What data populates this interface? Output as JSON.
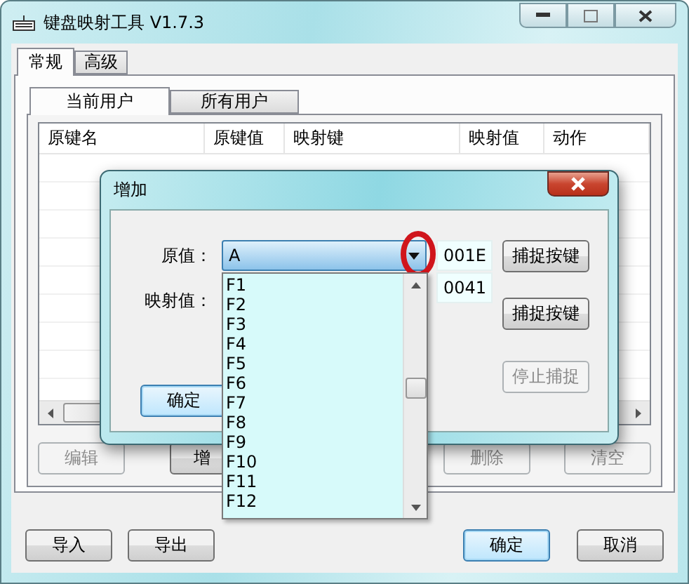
{
  "window": {
    "title": "键盘映射工具 V1.7.3"
  },
  "tabs": [
    {
      "label": "常规",
      "selected": true
    },
    {
      "label": "高级",
      "selected": false
    }
  ],
  "subtabs": [
    {
      "label": "当前用户",
      "selected": true
    },
    {
      "label": "所有用户",
      "selected": false
    }
  ],
  "table": {
    "columns": [
      "原键名",
      "原键值",
      "映射键",
      "映射值",
      "动作"
    ]
  },
  "list_buttons": [
    {
      "label": "编辑",
      "disabled": true
    },
    {
      "label": "增",
      "disabled": false
    },
    {
      "label": "删除",
      "disabled": true
    },
    {
      "label": "清空",
      "disabled": true
    }
  ],
  "footer_buttons": [
    {
      "label": "导入",
      "default": false
    },
    {
      "label": "导出",
      "default": false
    },
    {
      "label": "确定",
      "default": true
    },
    {
      "label": "取消",
      "default": false
    }
  ],
  "dialog": {
    "title": "增加",
    "rows": [
      {
        "label": "原值：",
        "value": "A",
        "code": "001E",
        "button": "捕捉按键"
      },
      {
        "label": "映射值：",
        "code": "0041",
        "button": "捕捉按键"
      }
    ],
    "stop_button": {
      "label": "停止捕捉",
      "disabled": true
    },
    "ok_button": {
      "label": "确定",
      "default": true
    },
    "dropdown": {
      "items": [
        "F1",
        "F2",
        "F3",
        "F4",
        "F5",
        "F6",
        "F7",
        "F8",
        "F9",
        "F10",
        "F11",
        "F12"
      ]
    }
  }
}
